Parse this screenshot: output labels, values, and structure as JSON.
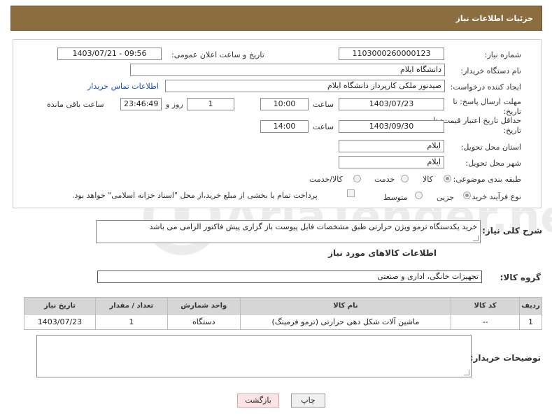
{
  "header": {
    "title": "جزئیات اطلاعات نیاز"
  },
  "form": {
    "need_number_label": "شماره نیاز:",
    "need_number": "1103000260000123",
    "announce_label": "تاریخ و ساعت اعلان عمومی:",
    "announce_value": "1403/07/21 - 09:56",
    "buyer_org_label": "نام دستگاه خریدار:",
    "buyer_org": "دانشگاه ایلام",
    "creator_label": "ایجاد کننده درخواست:",
    "creator": "صیدنور ملکی کارپرداز دانشگاه ایلام",
    "contact_link": "اطلاعات تماس خریدار",
    "deadline_label": "مهلت ارسال پاسخ: تا تاریخ:",
    "deadline_date": "1403/07/23",
    "time_label": "ساعت",
    "deadline_time": "10:00",
    "days_value": "1",
    "days_label": "روز و",
    "remaining_time": "23:46:49",
    "remaining_label": "ساعت باقی مانده",
    "validity_label": "حداقل تاریخ اعتبار قیمت: تا تاریخ:",
    "validity_date": "1403/09/30",
    "validity_time": "14:00",
    "province_label": "استان محل تحویل:",
    "province": "ایلام",
    "city_label": "شهر محل تحویل:",
    "city": "ایلام",
    "category_label": "طبقه بندی موضوعی:",
    "category_options": [
      "کالا",
      "خدمت",
      "کالا/خدمت"
    ],
    "process_label": "نوع فرآیند خرید :",
    "process_options": [
      "جزیی",
      "متوسط"
    ],
    "payment_note": "پرداخت تمام یا بخشی از مبلغ خرید،از محل \"اسناد خزانه اسلامی\" خواهد بود."
  },
  "description": {
    "label": "شرح کلی نیاز:",
    "text": "خرید یکدستگاه ترمو ویژن حرارتی  طبق مشخصات فایل پیوست باز گزاری پیش فاکتور الزامی می باشد"
  },
  "goods": {
    "section_title": "اطلاعات کالاهای مورد نیاز",
    "group_label": "گروه کالا:",
    "group_value": "تجهیزات خانگی، اداری و صنعتی",
    "columns": [
      "ردیف",
      "کد کالا",
      "نام کالا",
      "واحد شمارش",
      "تعداد / مقدار",
      "تاریخ نیاز"
    ],
    "rows": [
      {
        "row": "1",
        "code": "--",
        "name": "ماشین آلات شکل دهی حرارتی (ترمو فرمینگ)",
        "unit": "دستگاه",
        "qty": "1",
        "date": "1403/07/23"
      }
    ]
  },
  "notes": {
    "label": "توضیحات خریدار:"
  },
  "buttons": {
    "print": "چاپ",
    "back": "بازگشت"
  },
  "watermark": {
    "text": "AriaTender.neT"
  }
}
